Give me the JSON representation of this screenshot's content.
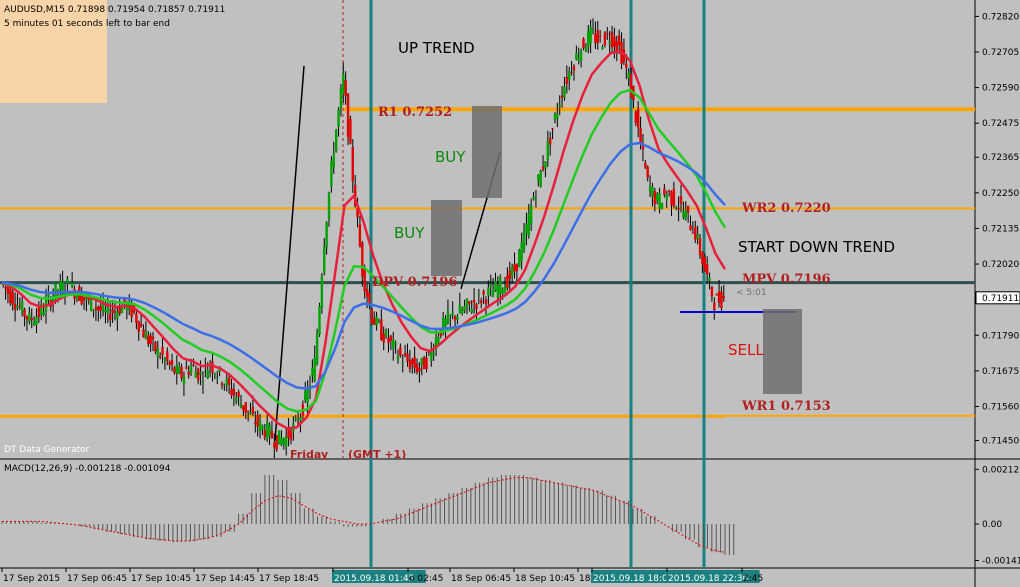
{
  "chart_data": {
    "type": "candlestick",
    "symbol_info": "AUDUSD,M15  0.71898 0.71954 0.71857 0.71911",
    "timer_text": "5 minutes 01 seconds left to bar end",
    "indicator_label": "DT Data Generator",
    "day_label": "Friday",
    "timezone_label": "(GMT +1)",
    "ylim": [
      0.714,
      0.7286
    ],
    "y_ticks": [
      "0.72820",
      "0.72705",
      "0.72590",
      "0.72475",
      "0.72365",
      "0.72250",
      "0.72135",
      "0.72020",
      "0.71911",
      "0.71790",
      "0.71675",
      "0.71560",
      "0.71450"
    ],
    "y_tick_values": [
      0.7282,
      0.72705,
      0.7259,
      0.72475,
      0.72365,
      0.7225,
      0.72135,
      0.7202,
      0.71911,
      0.7179,
      0.71675,
      0.7156,
      0.7145
    ],
    "current_price": "0.71911",
    "x_ticks": [
      "17 Sep 2015",
      "17 Sep 06:45",
      "17 Sep 10:45",
      "17 Sep 14:45",
      "17 Sep 18:45",
      "2015.09.18 01:45",
      "o 02:45",
      "18 Sep 06:45",
      "18 Sep 10:45",
      "18",
      "2015.09.18 18:0",
      "2015.09.18 22:30",
      "2:45"
    ],
    "highlighted_x_ticks": [
      5,
      10,
      11
    ],
    "levels": [
      {
        "name": "R1",
        "value": 0.7252,
        "label": "R1   0.7252",
        "color": "#ffa500"
      },
      {
        "name": "WR2",
        "value": 0.722,
        "label": "WR2   0.7220",
        "color": "#ffa500"
      },
      {
        "name": "MPV",
        "value": 0.7196,
        "label": "MPV   0.7196",
        "color": "#2f4f4f"
      },
      {
        "name": "DPV",
        "value": 0.7196,
        "label": "DPV   0.7196",
        "color": "#2f4f4f"
      },
      {
        "name": "WR1",
        "value": 0.7153,
        "label": "WR1   0.7153",
        "color": "#ffa500"
      }
    ],
    "annotations": {
      "up_trend": "UP TREND",
      "buy1": "BUY",
      "buy2": "BUY",
      "start_down": "START DOWN TREND",
      "sell": "SELL",
      "countdown": "< 5:01"
    },
    "close_series": [
      0.7196,
      0.7192,
      0.7188,
      0.7184,
      0.7186,
      0.719,
      0.7194,
      0.7195,
      0.7193,
      0.719,
      0.7188,
      0.7186,
      0.7187,
      0.7189,
      0.7186,
      0.718,
      0.7175,
      0.7172,
      0.7168,
      0.7166,
      0.7169,
      0.7166,
      0.717,
      0.7166,
      0.7162,
      0.7158,
      0.7154,
      0.715,
      0.7148,
      0.7145,
      0.7146,
      0.715,
      0.7158,
      0.717,
      0.721,
      0.724,
      0.7262,
      0.723,
      0.72,
      0.7185,
      0.718,
      0.7176,
      0.7172,
      0.717,
      0.7168,
      0.7172,
      0.718,
      0.7184,
      0.7186,
      0.7188,
      0.719,
      0.7192,
      0.7194,
      0.7196,
      0.72,
      0.721,
      0.7224,
      0.7234,
      0.7246,
      0.7258,
      0.7266,
      0.7272,
      0.7276,
      0.7274,
      0.7276,
      0.7272,
      0.7262,
      0.7245,
      0.7228,
      0.7222,
      0.7225,
      0.7222,
      0.7218,
      0.7212,
      0.72,
      0.719,
      0.7191
    ],
    "macd": {
      "label": "MACD(12,26,9) -0.001218 -0.001094",
      "ylim": [
        -0.00155,
        0.00225
      ],
      "y_ticks": [
        "0.002121",
        "0.00",
        "-0.001414"
      ],
      "y_tick_values": [
        0.002121,
        0.0,
        -0.001414
      ],
      "histogram": [
        0.0001,
        0.0001,
        0.0001,
        5e-05,
        3e-05,
        0.0,
        -0.0001,
        -0.0002,
        -0.0003,
        -0.0004,
        -0.0005,
        -0.0006,
        -0.00065,
        -0.0007,
        -0.00068,
        -0.0006,
        -0.0005,
        -0.0003,
        0.0004,
        0.0012,
        0.0019,
        0.0017,
        0.0012,
        0.0006,
        0.0003,
        0.0001,
        -0.0001,
        -0.0001,
        0.0,
        0.0002,
        0.0004,
        0.0006,
        0.0008,
        0.001,
        0.0012,
        0.0014,
        0.0016,
        0.0018,
        0.0019,
        0.0019,
        0.0018,
        0.0017,
        0.0016,
        0.0015,
        0.0014,
        0.0013,
        0.0011,
        0.0009,
        0.0006,
        0.0003,
        0.0,
        -0.0003,
        -0.0006,
        -0.0009,
        -0.0011,
        -0.0012
      ],
      "signal": [
        0.0001,
        0.0001,
        0.0001,
        0.0001,
        5e-05,
        0.0,
        -5e-05,
        -0.00015,
        -0.00025,
        -0.00035,
        -0.00045,
        -0.00055,
        -0.0006,
        -0.00065,
        -0.00066,
        -0.0006,
        -0.0005,
        -0.0003,
        0.0,
        0.0005,
        0.0009,
        0.0011,
        0.001,
        0.0007,
        0.0004,
        0.0002,
        0.0001,
        0.0,
        0.0,
        0.0001,
        0.0002,
        0.0004,
        0.0006,
        0.0008,
        0.001,
        0.0012,
        0.0014,
        0.0016,
        0.0017,
        0.0018,
        0.0018,
        0.0017,
        0.0016,
        0.0015,
        0.0014,
        0.0013,
        0.0011,
        0.0009,
        0.0007,
        0.0004,
        0.0001,
        -0.0002,
        -0.0005,
        -0.0008,
        -0.001,
        -0.0011
      ]
    }
  },
  "colors": {
    "background": "#c0c0c0",
    "bull": "#00a000",
    "bear": "#e00000",
    "ema_red": "#e8203c",
    "ema_green": "#22cc22",
    "ema_blue": "#3c6ee8",
    "vline": "#1a8080",
    "info_box": "#f8d4a8"
  },
  "icons": [
    "chart-icon",
    "sell-box",
    "buy-box"
  ]
}
